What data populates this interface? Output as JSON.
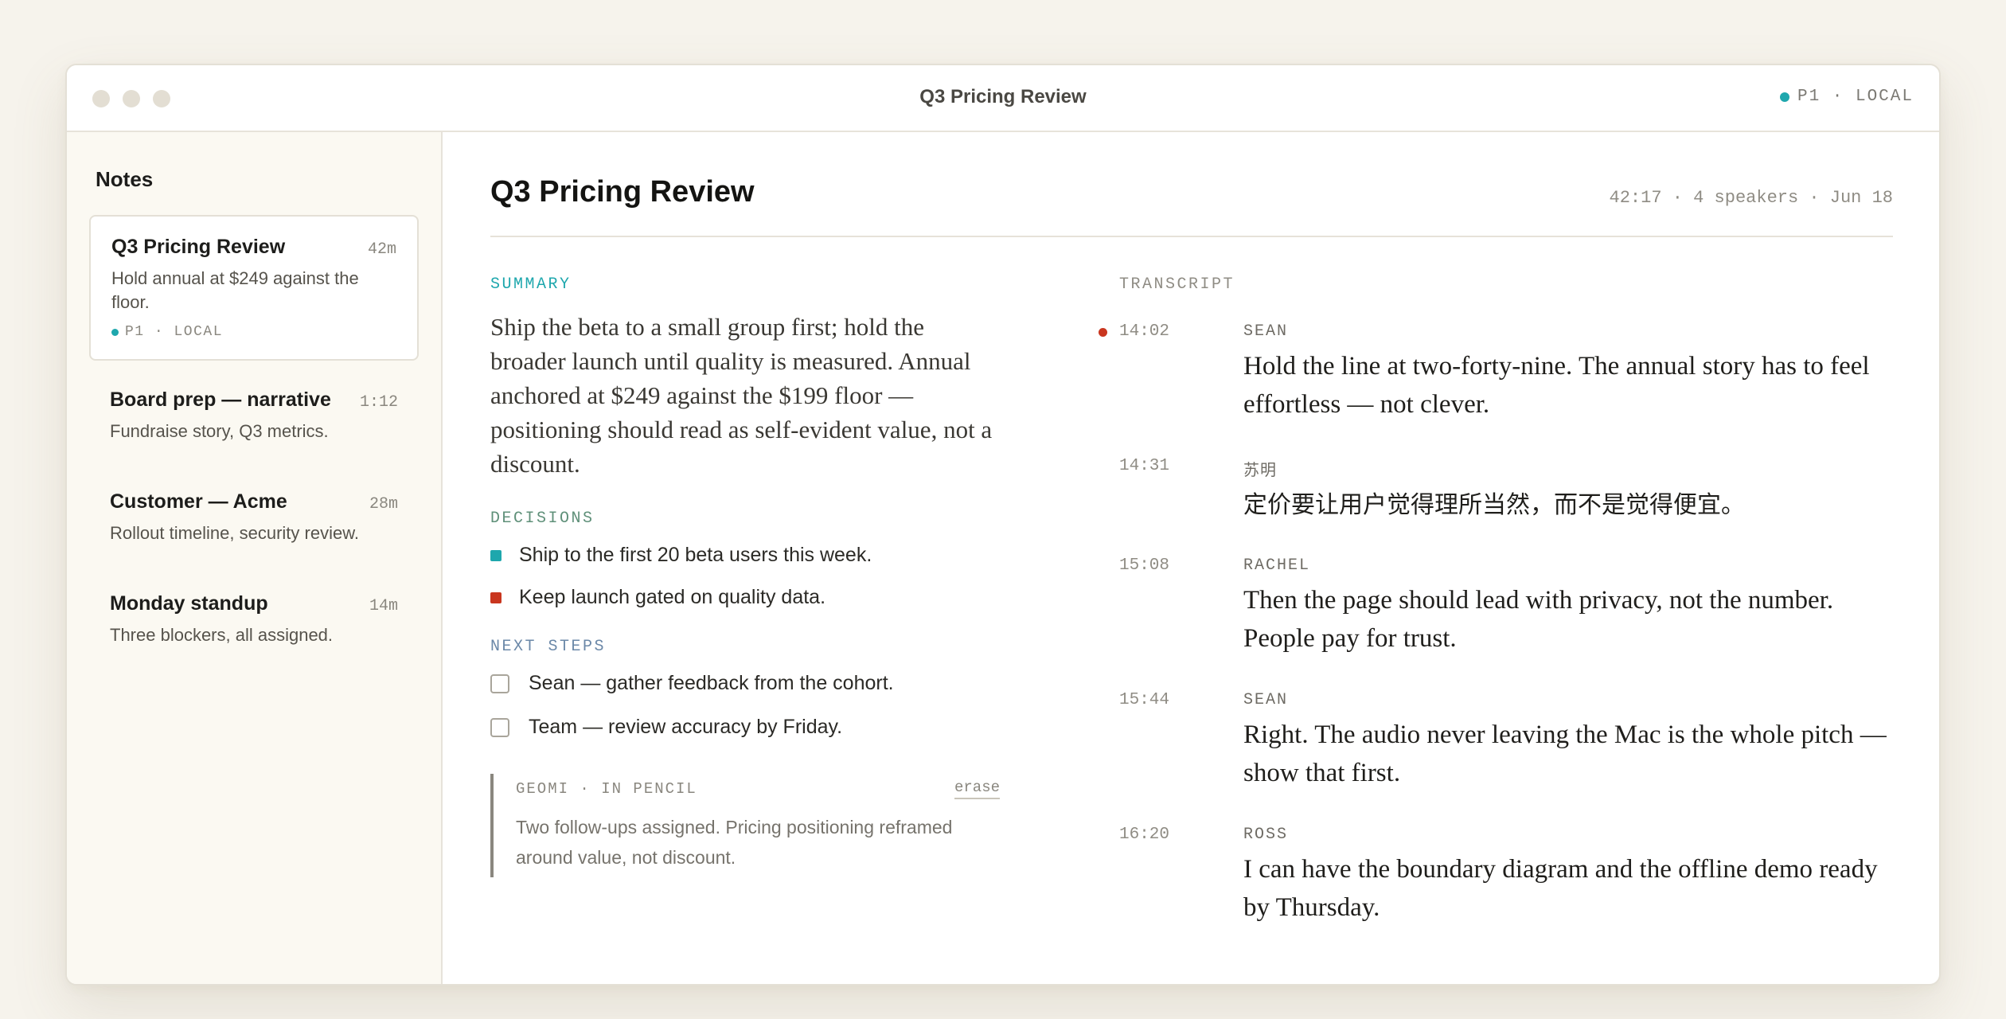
{
  "window": {
    "title": "Q3 Pricing Review",
    "status_label": "P1 · LOCAL"
  },
  "colors": {
    "accent_teal": "#1ea7ad",
    "accent_red": "#c9361f",
    "decisions_green": "#5f9079",
    "next_steps_blue": "#6b88a8"
  },
  "sidebar": {
    "title": "Notes",
    "notes": [
      {
        "title": "Q3 Pricing Review",
        "duration": "42m",
        "snippet": "Hold annual at $249 against the floor.",
        "tag": "P1 · LOCAL",
        "active": true
      },
      {
        "title": "Board prep — narrative",
        "duration": "1:12",
        "snippet": "Fundraise story, Q3 metrics."
      },
      {
        "title": "Customer — Acme",
        "duration": "28m",
        "snippet": "Rollout timeline, security review."
      },
      {
        "title": "Monday standup",
        "duration": "14m",
        "snippet": "Three blockers, all assigned."
      }
    ]
  },
  "doc": {
    "title": "Q3 Pricing Review",
    "meta": "42:17 · 4 speakers · Jun 18",
    "summary_label": "SUMMARY",
    "summary": "Ship the beta to a small group first; hold the broader launch until quality is measured. Annual anchored at $249 against the $199 floor — positioning should read as self-evident value, not a discount.",
    "decisions_label": "DECISIONS",
    "decisions": [
      {
        "text": "Ship to the first 20 beta users this week.",
        "color": "#1ea7ad"
      },
      {
        "text": "Keep launch gated on quality data.",
        "color": "#c9361f"
      }
    ],
    "next_steps_label": "NEXT STEPS",
    "next_steps": [
      {
        "text": "Sean — gather feedback from the cohort."
      },
      {
        "text": "Team — review accuracy by Friday."
      }
    ],
    "pencil": {
      "label": "GEOMI · IN PENCIL",
      "erase_label": "erase",
      "text": "Two follow-ups assigned. Pricing positioning reframed around value, not discount."
    }
  },
  "transcript": {
    "label": "TRANSCRIPT",
    "entries": [
      {
        "time": "14:02",
        "speaker": "SEAN",
        "text": "Hold the line at two-forty-nine. The annual story has to feel effortless — not clever.",
        "live": true
      },
      {
        "time": "14:31",
        "speaker": "苏明",
        "text": "定价要让用户觉得理所当然，而不是觉得便宜。"
      },
      {
        "time": "15:08",
        "speaker": "RACHEL",
        "text": "Then the page should lead with privacy, not the number. People pay for trust."
      },
      {
        "time": "15:44",
        "speaker": "SEAN",
        "text": "Right. The audio never leaving the Mac is the whole pitch — show that first."
      },
      {
        "time": "16:20",
        "speaker": "ROSS",
        "text": "I can have the boundary diagram and the offline demo ready by Thursday."
      }
    ]
  }
}
